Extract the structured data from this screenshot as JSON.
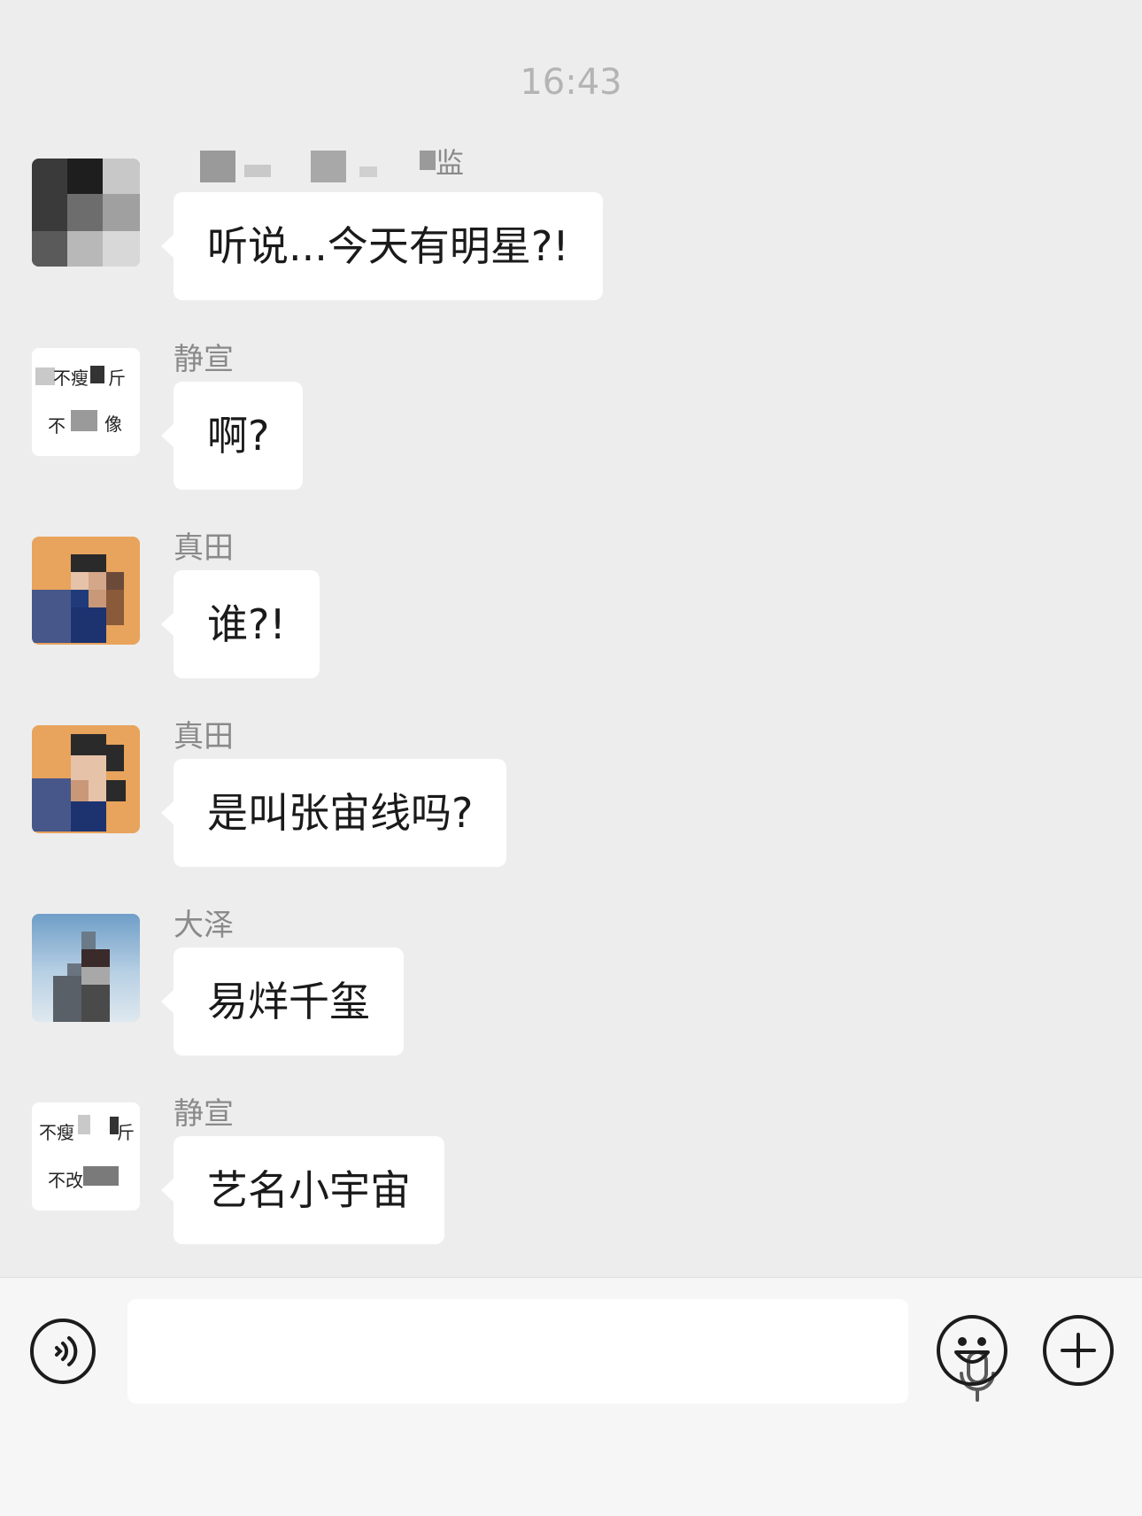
{
  "timestamp": "16:43",
  "messages": [
    {
      "sender": "",
      "text": "听说...今天有明星?!"
    },
    {
      "sender": "静宣",
      "text": "啊?"
    },
    {
      "sender": "真田",
      "text": "谁?!"
    },
    {
      "sender": "真田",
      "text": "是叫张宙线吗?"
    },
    {
      "sender": "大泽",
      "text": "易烊千玺"
    },
    {
      "sender": "静宣",
      "text": "艺名小宇宙"
    }
  ],
  "avatars": {
    "a2_top": "不瘦",
    "a2_top_right": "斤",
    "a2_bottom": "不",
    "a2_bottom_right": "像",
    "a6_top": "不瘦",
    "a6_top_right": "斤",
    "a6_bottom": "不改"
  },
  "sender_blur_visible": "监",
  "input_bar": {
    "voice_icon": "voice-toggle-icon",
    "mic_icon": "microphone-icon",
    "emoji_icon": "emoji-icon",
    "plus_icon": "plus-icon"
  },
  "colors": {
    "background": "#ededed",
    "bubble": "#ffffff",
    "sender_name": "#8a8a8a",
    "timestamp": "#b4b4b4"
  }
}
